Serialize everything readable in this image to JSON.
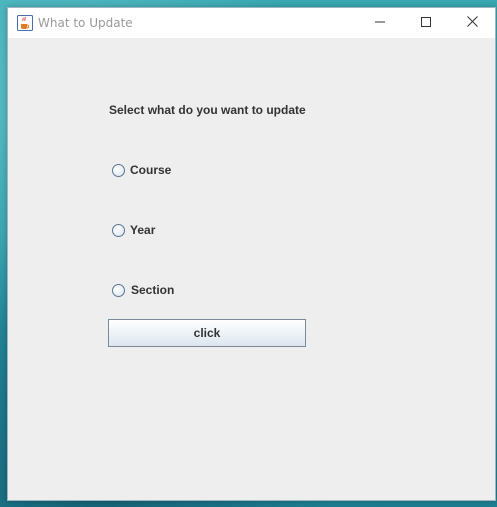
{
  "window": {
    "title": "What to Update",
    "app_icon": "java-cup-icon",
    "controls": {
      "minimize_icon": "minimize-icon",
      "maximize_icon": "maximize-icon",
      "close_icon": "close-icon"
    }
  },
  "form": {
    "prompt": "Select what do you want to update",
    "options": [
      {
        "label": "Course",
        "selected": false
      },
      {
        "label": "Year",
        "selected": false
      },
      {
        "label": "Section",
        "selected": false
      }
    ],
    "button_label": "click"
  },
  "colors": {
    "window_background": "#eeeeee",
    "titlebar_background": "#ffffff",
    "title_text": "#999999",
    "label_text": "#333333",
    "radio_border": "#5a7594",
    "button_border": "#7a8a99",
    "desktop": "#2c9aa7"
  }
}
